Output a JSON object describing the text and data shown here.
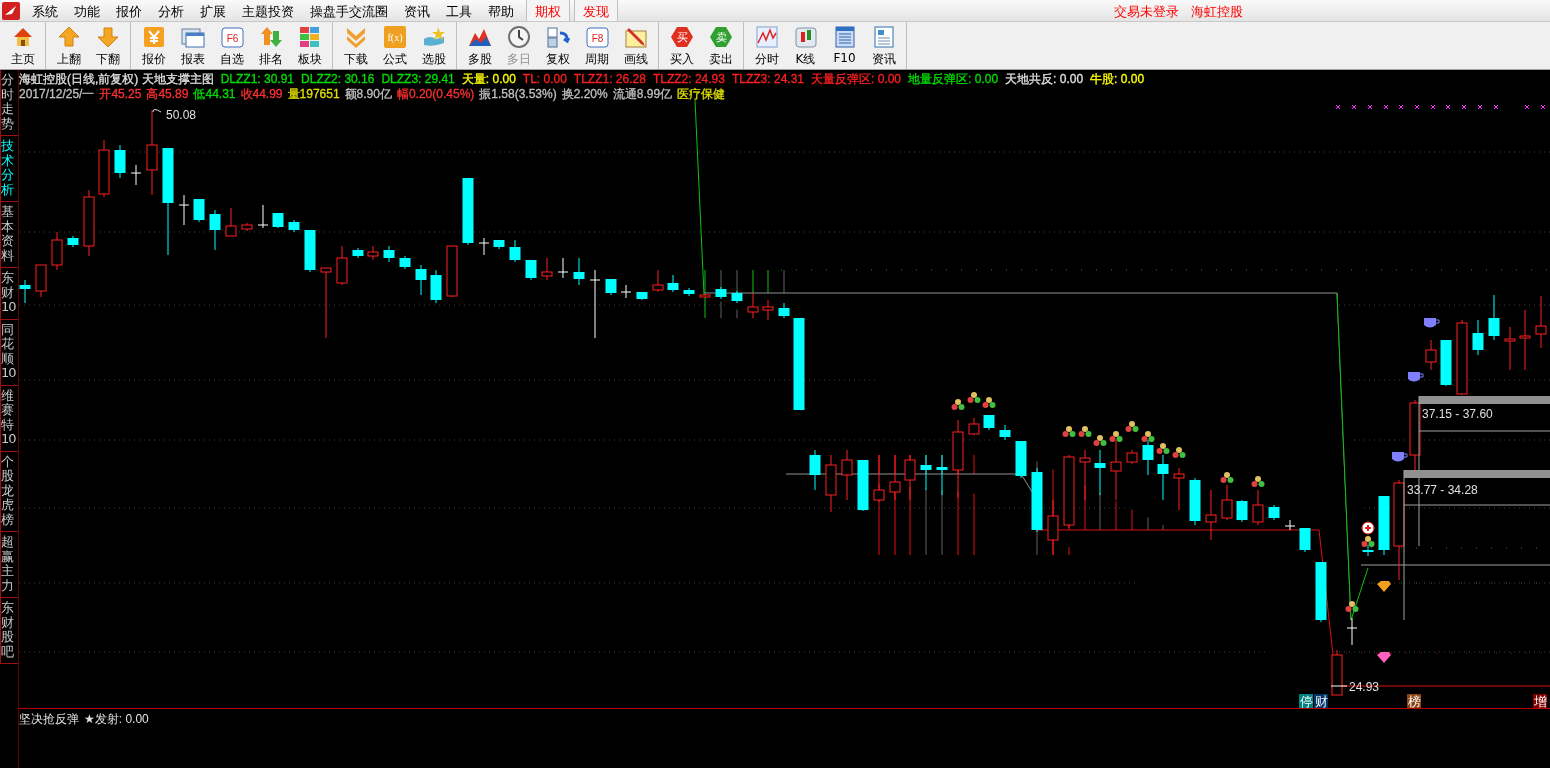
{
  "menu": {
    "items": [
      {
        "label": "系统",
        "kind": "normal"
      },
      {
        "label": "功能",
        "kind": "normal"
      },
      {
        "label": "报价",
        "kind": "normal"
      },
      {
        "label": "分析",
        "kind": "normal"
      },
      {
        "label": "扩展",
        "kind": "normal"
      },
      {
        "label": "主题投资",
        "kind": "normal"
      },
      {
        "label": "操盘手交流圈",
        "kind": "normal"
      },
      {
        "label": "资讯",
        "kind": "normal"
      },
      {
        "label": "工具",
        "kind": "normal"
      },
      {
        "label": "帮助",
        "kind": "normal"
      },
      {
        "label": "期权",
        "kind": "highlight"
      },
      {
        "label": "发现",
        "kind": "highlight"
      }
    ],
    "status": [
      "交易未登录",
      "海虹控股"
    ]
  },
  "toolbar": [
    [
      {
        "label": "主页",
        "kind": "home",
        "disabled": false
      }
    ],
    [
      {
        "label": "上翻",
        "kind": "up",
        "disabled": false
      },
      {
        "label": "下翻",
        "kind": "down",
        "disabled": false
      }
    ],
    [
      {
        "label": "报价",
        "kind": "yen",
        "disabled": false
      },
      {
        "label": "报表",
        "kind": "window",
        "disabled": false
      },
      {
        "label": "自选",
        "kind": "key",
        "icon_text": "F6",
        "disabled": false
      },
      {
        "label": "排名",
        "kind": "rank",
        "disabled": false
      },
      {
        "label": "板块",
        "kind": "grid",
        "disabled": false
      }
    ],
    [
      {
        "label": "下载",
        "kind": "download",
        "disabled": false
      },
      {
        "label": "公式",
        "kind": "formula",
        "icon_text": "f(x)",
        "disabled": false
      },
      {
        "label": "选股",
        "kind": "hand",
        "disabled": false
      }
    ],
    [
      {
        "label": "多股",
        "kind": "mountain",
        "disabled": false
      },
      {
        "label": "多日",
        "kind": "clock",
        "disabled": true
      },
      {
        "label": "复权",
        "kind": "restore",
        "disabled": false
      },
      {
        "label": "周期",
        "kind": "key",
        "icon_text": "F8",
        "disabled": false
      },
      {
        "label": "画线",
        "kind": "pencil",
        "disabled": false
      }
    ],
    [
      {
        "label": "买入",
        "kind": "hex",
        "icon_text": "买",
        "color": "#e03020",
        "disabled": false
      },
      {
        "label": "卖出",
        "kind": "hex",
        "icon_text": "卖",
        "color": "#30a030",
        "disabled": false
      }
    ],
    [
      {
        "label": "分时",
        "kind": "line",
        "disabled": false
      },
      {
        "label": "K线",
        "kind": "candle",
        "disabled": false
      },
      {
        "label": "F10",
        "kind": "doc",
        "disabled": false
      },
      {
        "label": "资讯",
        "kind": "news",
        "disabled": false
      }
    ]
  ],
  "side_tabs": [
    {
      "label": "分时走势",
      "selected": false
    },
    {
      "label": "技术分析",
      "selected": true
    },
    {
      "label": "基本资料",
      "selected": false
    },
    {
      "label": "东财10",
      "selected": false
    },
    {
      "label": "同花顺10",
      "selected": false
    },
    {
      "label": "维赛特10",
      "selected": false
    },
    {
      "label": "个股龙虎榜",
      "selected": false
    },
    {
      "label": "超赢主力",
      "selected": false
    },
    {
      "label": "东财股吧",
      "selected": false
    }
  ],
  "info_line_1": [
    {
      "text": "海虹控股(日线,前复权) 天地支撑主图",
      "color": "#e0e0e0"
    },
    {
      "text": "DLZZ1: 30.91",
      "color": "#00e000"
    },
    {
      "text": "DLZZ2: 30.16",
      "color": "#00e000"
    },
    {
      "text": "DLZZ3: 29.41",
      "color": "#00e000"
    },
    {
      "text": "天量: 0.00",
      "color": "#ffff00"
    },
    {
      "text": "TL: 0.00",
      "color": "#ff2020"
    },
    {
      "text": "TLZZ1: 26.28",
      "color": "#ff2020"
    },
    {
      "text": "TLZZ2: 24.93",
      "color": "#ff2020"
    },
    {
      "text": "TLZZ3: 24.31",
      "color": "#ff2020"
    },
    {
      "text": "天量反弹区: 0.00",
      "color": "#ff2020"
    },
    {
      "text": "地量反弹区: 0.00",
      "color": "#00e000"
    },
    {
      "text": "天地共反: 0.00",
      "color": "#e0e0e0"
    },
    {
      "text": "牛股: 0.00",
      "color": "#ffff00"
    }
  ],
  "info_line_2": [
    {
      "text": "2017/12/25/一",
      "color": "#c0c0c0"
    },
    {
      "text": "开45.25",
      "color": "#ff3030"
    },
    {
      "text": "高45.89",
      "color": "#ff3030"
    },
    {
      "text": "低44.31",
      "color": "#00e000"
    },
    {
      "text": "收44.99",
      "color": "#ff3030"
    },
    {
      "text": "量197651",
      "color": "#e0e000"
    },
    {
      "text": "额8.90亿",
      "color": "#c0c0c0"
    },
    {
      "text": "幅0.20(0.45%)",
      "color": "#ff3030"
    },
    {
      "text": "振1.58(3.53%)",
      "color": "#c0c0c0"
    },
    {
      "text": "换2.20%",
      "color": "#c0c0c0"
    },
    {
      "text": "流通8.99亿",
      "color": "#c0c0c0"
    },
    {
      "text": "医疗保健",
      "color": "#e0e000"
    }
  ],
  "chart": {
    "high_label": "50.08",
    "low_label": "24.93",
    "zones": [
      "37.15 - 37.60",
      "33.77 - 34.28"
    ],
    "markers": [
      {
        "label": "停",
        "color": "#008080"
      },
      {
        "label": "财",
        "color": "#003366"
      },
      {
        "label": "榜",
        "color": "#8b4513"
      },
      {
        "label": "增",
        "color": "#800000"
      }
    ]
  },
  "lower_pane": {
    "title": "坚决抢反弹",
    "value": "★发射: 0.00"
  }
}
